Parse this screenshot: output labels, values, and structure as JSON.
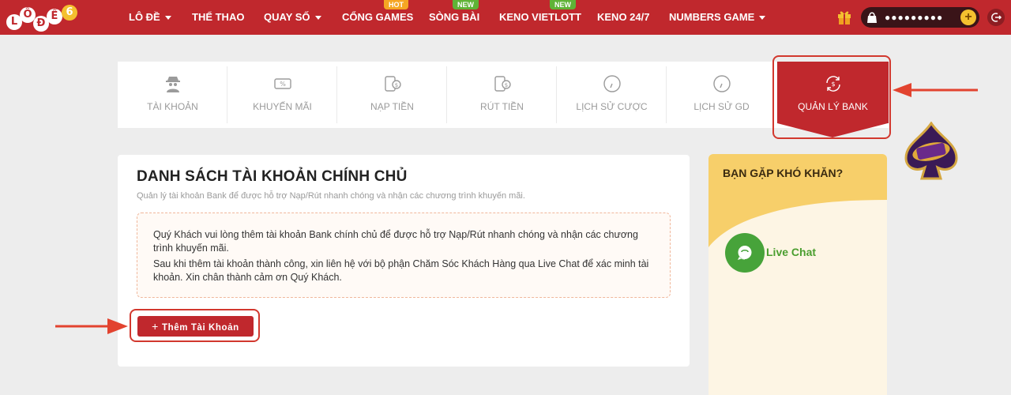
{
  "nav": {
    "logo_letters": [
      "L",
      "Ô",
      "Đ",
      "Ề",
      "6"
    ],
    "items": [
      {
        "label": "LÔ ĐỀ",
        "dropdown": true
      },
      {
        "label": "THỂ THAO",
        "dropdown": false
      },
      {
        "label": "QUAY SỐ",
        "dropdown": true
      },
      {
        "label": "CỔNG GAMES",
        "dropdown": false,
        "badge": "HOT"
      },
      {
        "label": "SÒNG BÀI",
        "dropdown": false,
        "badge": "NEW"
      },
      {
        "label": "KENO VIETLOTT",
        "dropdown": false,
        "badge": "NEW"
      },
      {
        "label": "KENO 24/7",
        "dropdown": false
      },
      {
        "label": "NUMBERS GAME",
        "dropdown": true
      }
    ],
    "wallet_masked": "●●●●●●●●●",
    "wallet_plus": "+"
  },
  "tabs": [
    {
      "label": "TÀI KHOẢN",
      "icon": "user-spy-icon"
    },
    {
      "label": "KHUYẾN MÃI",
      "icon": "promo-ticket-icon"
    },
    {
      "label": "NẠP TIỀN",
      "icon": "deposit-icon"
    },
    {
      "label": "RÚT TIỀN",
      "icon": "withdraw-icon"
    },
    {
      "label": "LỊCH SỬ CƯỢC",
      "icon": "clock-icon"
    },
    {
      "label": "LỊCH SỬ GD",
      "icon": "clock-icon"
    },
    {
      "label": "QUẢN LÝ BANK",
      "icon": "bank-exchange-icon",
      "active": true
    }
  ],
  "main": {
    "title": "DANH SÁCH TÀI KHOẢN CHÍNH CHỦ",
    "subtitle": "Quản lý tài khoản Bank để được hỗ trợ Nạp/Rút nhanh chóng và nhận các chương trình khuyến mãi.",
    "notice_line1": "Quý Khách vui lòng thêm tài khoản Bank chính chủ để được hỗ trợ Nạp/Rút nhanh chóng và nhận các chương trình khuyến mãi.",
    "notice_line2": "Sau khi thêm tài khoản thành công, xin liên hệ với bộ phận Chăm Sóc Khách Hàng qua Live Chat để xác minh tài khoản. Xin chân thành cảm ơn Quý Khách.",
    "add_button": "Thêm Tài Khoản",
    "add_button_icon": "+"
  },
  "help": {
    "title": "BẠN GẶP KHÓ KHĂN?",
    "live_chat": "Live Chat"
  },
  "colors": {
    "brand_red": "#c0282d",
    "highlight_red": "#d2382e",
    "arrow_red": "#e2432f",
    "live_chat_green": "#47a33a",
    "help_band_yellow": "#f7cf6a"
  }
}
